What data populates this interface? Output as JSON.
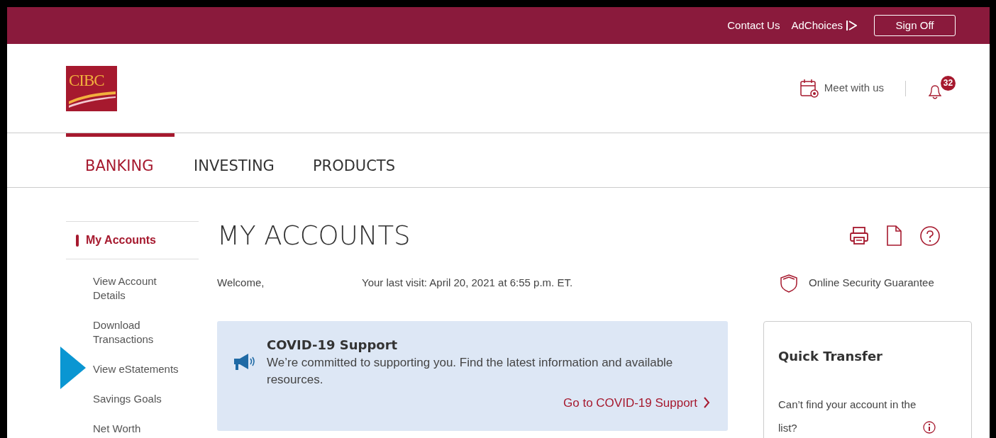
{
  "top_bar": {
    "links": [
      "Contact Us",
      "AdChoices"
    ],
    "sign_off": "Sign Off"
  },
  "logo": "CIBC",
  "header": {
    "meet": "Meet with us",
    "notifications": "32"
  },
  "nav": [
    {
      "label": "BANKING",
      "selected": true
    },
    {
      "label": "INVESTING",
      "selected": false
    },
    {
      "label": "PRODUCTS",
      "selected": false
    }
  ],
  "sidebar": {
    "items": [
      {
        "label": "My Accounts",
        "selected": true
      },
      {
        "label": "View Account Details",
        "selected": false
      },
      {
        "label": "Download Transactions",
        "selected": false
      },
      {
        "label": "View eStatements",
        "selected": false
      },
      {
        "label": "Savings Goals",
        "selected": false
      },
      {
        "label": "Net Worth",
        "selected": false
      }
    ]
  },
  "page_title": "MY ACCOUNTS",
  "welcome": "Welcome,",
  "last_visit": "Your last visit: April 20, 2021 at 6:55 p.m. ET.",
  "security": "Online Security Guarantee",
  "covid": {
    "title": "COVID-19 Support",
    "text": "We’re committed to supporting you. Find the latest information and available resources.",
    "link": "Go to COVID-19 Support"
  },
  "quick_transfer": {
    "title": "Quick Transfer",
    "text": "Can’t find your account in the list?"
  }
}
